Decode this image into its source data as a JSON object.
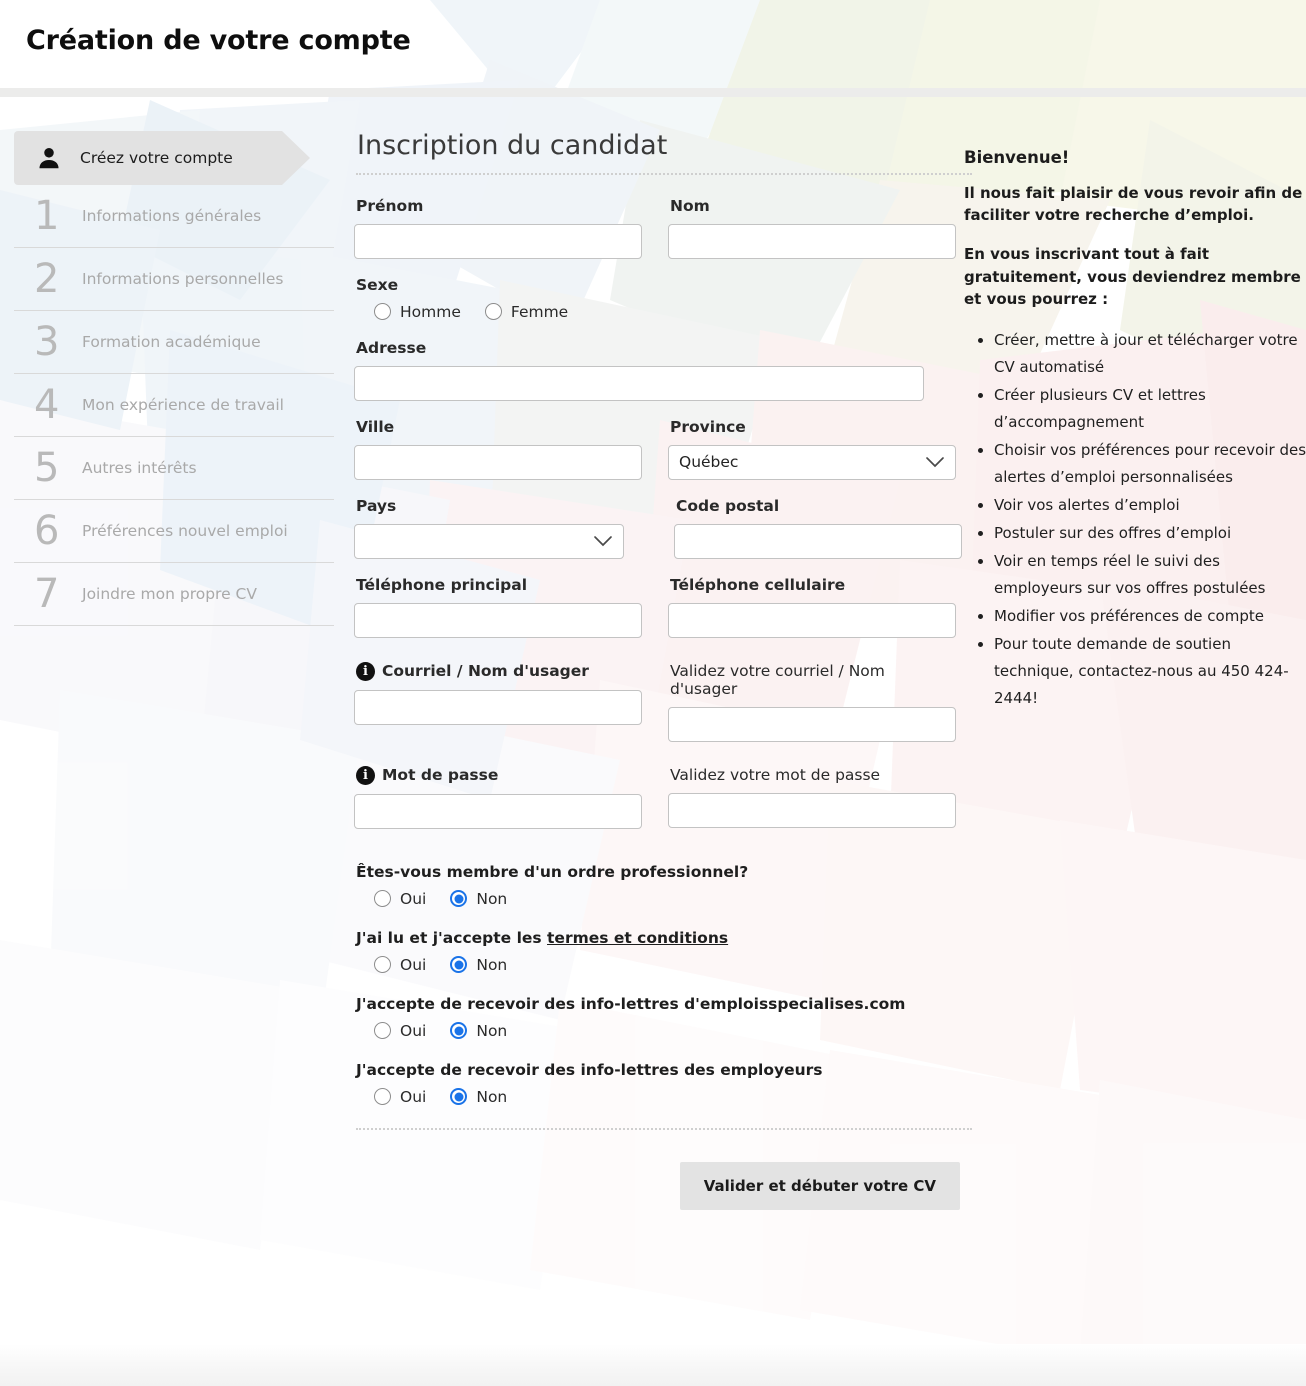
{
  "header": {
    "title": "Création de votre compte"
  },
  "steps": [
    {
      "num": "",
      "icon": "user-icon",
      "label": "Créez votre compte",
      "active": true
    },
    {
      "num": "1",
      "label": "Informations générales",
      "active": false
    },
    {
      "num": "2",
      "label": "Informations personnelles",
      "active": false
    },
    {
      "num": "3",
      "label": "Formation académique",
      "active": false
    },
    {
      "num": "4",
      "label": "Mon expérience de travail",
      "active": false
    },
    {
      "num": "5",
      "label": "Autres intérêts",
      "active": false
    },
    {
      "num": "6",
      "label": "Préférences nouvel emploi",
      "active": false
    },
    {
      "num": "7",
      "label": "Joindre mon propre CV",
      "active": false
    }
  ],
  "form": {
    "title": "Inscription du candidat",
    "prenom_label": "Prénom",
    "prenom_value": "",
    "nom_label": "Nom",
    "nom_value": "",
    "sexe_label": "Sexe",
    "sexe_options": [
      "Homme",
      "Femme"
    ],
    "sexe_selected": "",
    "adresse_label": "Adresse",
    "adresse_value": "",
    "ville_label": "Ville",
    "ville_value": "",
    "province_label": "Province",
    "province_value": "Québec",
    "pays_label": "Pays",
    "pays_value": "",
    "code_postal_label": "Code postal",
    "code_postal_value": "",
    "tel_principal_label": "Téléphone principal",
    "tel_principal_value": "",
    "tel_cellulaire_label": "Téléphone cellulaire",
    "tel_cellulaire_value": "",
    "courriel_label": "Courriel / Nom d'usager",
    "courriel_value": "",
    "courriel_valide_label": "Validez votre courriel / Nom d'usager",
    "courriel_valide_value": "",
    "mdp_label": "Mot de passe",
    "mdp_value": "",
    "mdp_valide_label": "Validez votre mot de passe",
    "mdp_valide_value": "",
    "questions": [
      {
        "text": "Êtes-vous membre d'un ordre professionnel?",
        "link": "",
        "tail": "",
        "oui": "Oui",
        "non": "Non",
        "selected": "Non"
      },
      {
        "text": "J'ai lu et j'accepte les ",
        "link": "termes et conditions",
        "tail": "",
        "oui": "Oui",
        "non": "Non",
        "selected": "Non"
      },
      {
        "text": "J'accepte de recevoir des info-lettres d'emploisspecialises.com",
        "link": "",
        "tail": "",
        "oui": "Oui",
        "non": "Non",
        "selected": "Non"
      },
      {
        "text": "J'accepte de recevoir des info-lettres des employeurs",
        "link": "",
        "tail": "",
        "oui": "Oui",
        "non": "Non",
        "selected": "Non"
      }
    ],
    "submit_label": "Valider et débuter votre CV"
  },
  "aside": {
    "heading": "Bienvenue!",
    "para1": "Il nous fait plaisir de vous revoir afin de faciliter votre recherche d’emploi.",
    "para2": "En vous inscrivant tout à fait gratuitement, vous deviendrez membre et vous pourrez :",
    "bullets": [
      "Créer, mettre à jour et télécharger votre CV automatisé",
      "Créer plusieurs CV et lettres d’accompagnement",
      "Choisir vos préférences pour recevoir des alertes d’emploi personnalisées",
      "Voir vos alertes d’emploi",
      "Postuler sur des offres d’emploi",
      "Voir en temps réel le suivi des employeurs sur vos offres postulées",
      "Modifier vos préférences de compte",
      "Pour toute demande de soutien technique, contactez-nous au 450 424-2444!"
    ]
  },
  "colors": {
    "accent_radio": "#1a73e8",
    "active_step_bg": "#e2e2e2",
    "button_bg": "#e3e3e3",
    "header_rule": "#ececeb"
  }
}
